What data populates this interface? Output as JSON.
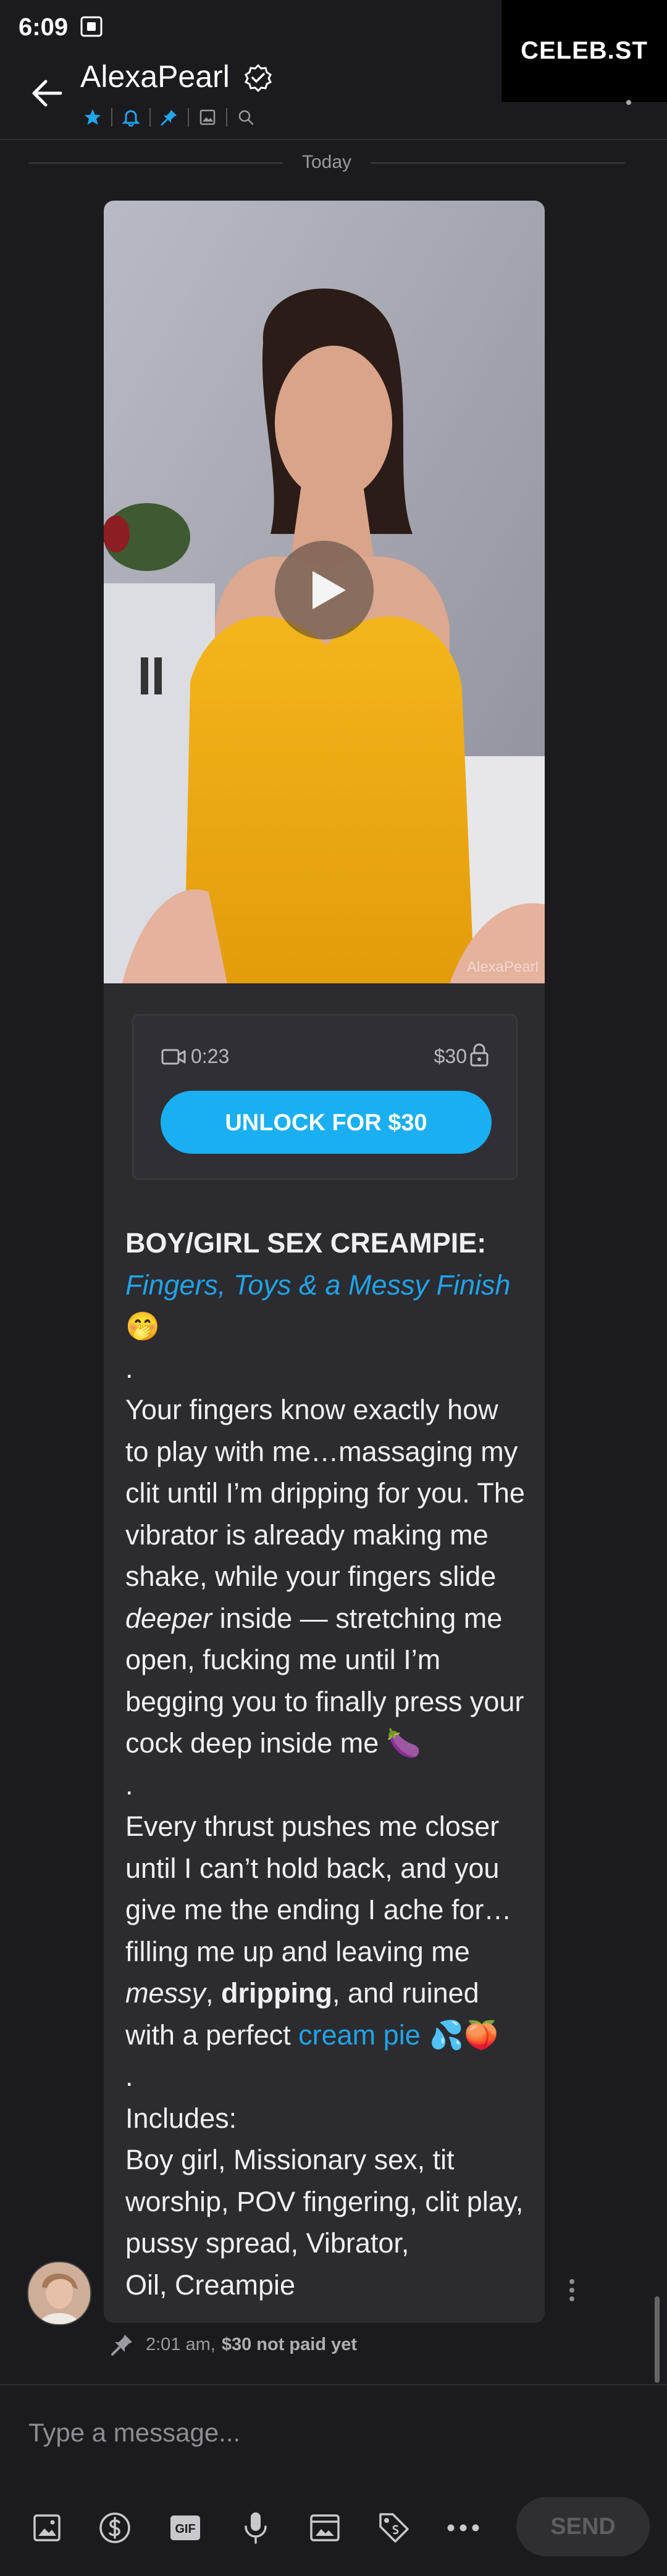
{
  "status_bar": {
    "time": "6:09"
  },
  "watermark": {
    "text": "CELEB.ST"
  },
  "header": {
    "title": "AlexaPearl",
    "icons": [
      "star-icon",
      "bell-icon",
      "pin-icon",
      "image-icon",
      "search-icon"
    ]
  },
  "date_separator": "Today",
  "message": {
    "media": {
      "watermark": "AlexaPearl"
    },
    "locked": {
      "duration": "0:23",
      "price": "$30",
      "unlock_label": "UNLOCK FOR $30"
    },
    "caption": {
      "heading": "BOY/GIRL SEX CREAMPIE:",
      "subheading": "Fingers, Toys & a Messy Finish",
      "emoji_1": "🤭",
      "dot_1": ".",
      "para_1_a": "Your fingers know exactly how to play with me…massaging my clit until I’m dripping for you. The vibrator is already making me shake, while your fingers slide ",
      "para_1_em": "deeper",
      "para_1_b": " inside — stretching me open, fucking me until I’m begging you to finally press your cock deep inside me ",
      "emoji_2": "🍆",
      "dot_2": ".",
      "para_2_a": "Every thrust pushes me closer until I can’t hold back, and you give me the ending I ache for…filling me up and leaving me ",
      "para_2_em": "messy",
      "para_2_sep": ", ",
      "para_2_bold": "dripping",
      "para_2_b": ", and ruined with a perfect ",
      "para_2_link": "cream pie",
      "emoji_3": " 💦🍑",
      "dot_3": ".",
      "includes_label": "Includes:",
      "includes_text": "Boy girl, Missionary sex, tit worship, POV fingering, clit play, pussy spread, Vibrator,",
      "includes_last": "Oil, Creampie"
    },
    "meta": {
      "time": "2:01 am,",
      "status": "$30 not paid yet"
    }
  },
  "composer": {
    "placeholder": "Type a message...",
    "send_label": "SEND",
    "gif_label": "GIF",
    "tools": [
      "image-icon",
      "dollar-icon",
      "gif-icon",
      "microphone-icon",
      "vault-icon",
      "price-tag-icon",
      "more-icon"
    ]
  },
  "colors": {
    "background": "#1b1b1f",
    "bubble": "#2b2b30",
    "accent": "#1aaff0",
    "link": "#21a3e8"
  }
}
